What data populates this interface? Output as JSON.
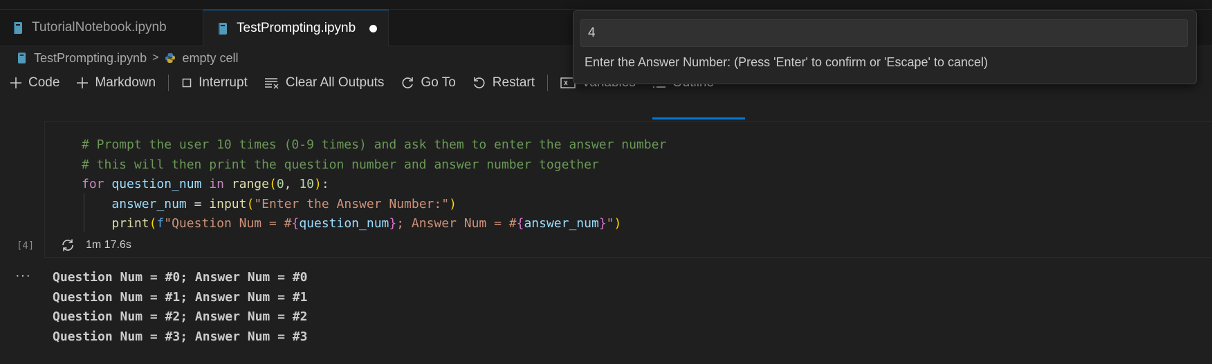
{
  "tabs": [
    {
      "label": "TutorialNotebook.ipynb",
      "active": false
    },
    {
      "label": "TestPrompting.ipynb",
      "active": true,
      "dirty": true
    }
  ],
  "breadcrumb": {
    "file": "TestPrompting.ipynb",
    "item": "empty cell"
  },
  "toolbar": {
    "code": "Code",
    "markdown": "Markdown",
    "interrupt": "Interrupt",
    "clear_outputs": "Clear All Outputs",
    "go_to": "Go To",
    "restart": "Restart",
    "variables": "Variables",
    "outline": "Outline",
    "more": "···"
  },
  "quick_input": {
    "value": "4",
    "message": "Enter the Answer Number: (Press 'Enter' to confirm or 'Escape' to cancel)"
  },
  "cell": {
    "execution_count": "[4]",
    "duration": "1m 17.6s",
    "code_lines": [
      "# Prompt the user 10 times (0-9 times) and ask them to enter the answer number",
      "# this will then print the question number and answer number together",
      "for question_num in range(0, 10):",
      "    answer_num = input(\"Enter the Answer Number:\")",
      "    print(f\"Question Num = #{question_num}; Answer Num = #{answer_num}\")"
    ],
    "outputs": [
      "Question Num = #0; Answer Num = #0",
      "Question Num = #1; Answer Num = #1",
      "Question Num = #2; Answer Num = #2",
      "Question Num = #3; Answer Num = #3"
    ],
    "output_more": "···"
  },
  "colors": {
    "accent": "#0078d4",
    "editor_bg": "#1f1f1f",
    "comment": "#6a9955",
    "keyword": "#c586c0",
    "variable": "#9cdcfe",
    "function": "#dcdcaa",
    "string": "#ce9178",
    "number": "#b5cea8"
  },
  "icons": [
    "notebook-icon",
    "python-icon",
    "plus-icon",
    "stop-icon",
    "clear-outputs-icon",
    "go-to-icon",
    "restart-icon",
    "variables-icon",
    "outline-icon",
    "executing-icon"
  ]
}
